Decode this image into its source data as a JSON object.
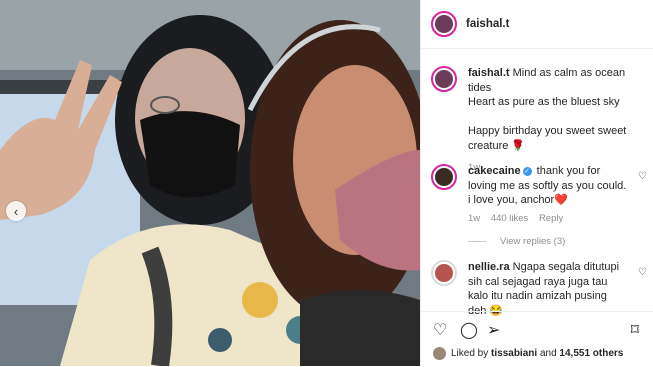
{
  "post": {
    "username": "faishal.t",
    "caption_line1": "Mind as calm as ocean tides",
    "caption_line2": "Heart as pure as the bluest sky",
    "caption_line3": "Happy birthday you sweet sweet creature 🌹",
    "caption_time": "1w"
  },
  "comments": [
    {
      "username": "cakecaine",
      "text": "thank you for loving me as softly as you could. i love you, anchor❤️",
      "time": "1w",
      "likes": "440 likes",
      "reply": "Reply",
      "view_replies": "View replies (3)"
    },
    {
      "username": "nellie.ra",
      "text": "Ngapa segala ditutupi sih cal sejagad raya juga tau kalo itu nadin amizah pusing deh 😂"
    }
  ],
  "footer": {
    "liked_prefix": "Liked by",
    "liked_user": "tissabiani",
    "liked_and": "and",
    "liked_count": "14,551 others"
  },
  "colors": {
    "story_ring": "#d6249f",
    "verified": "#3897f0",
    "muted_text": "#8e8e8e",
    "divider": "#efefef"
  },
  "icons": [
    "chevron-left-icon",
    "heart-icon",
    "comment-icon",
    "share-icon",
    "bookmark-icon",
    "verified-icon"
  ]
}
